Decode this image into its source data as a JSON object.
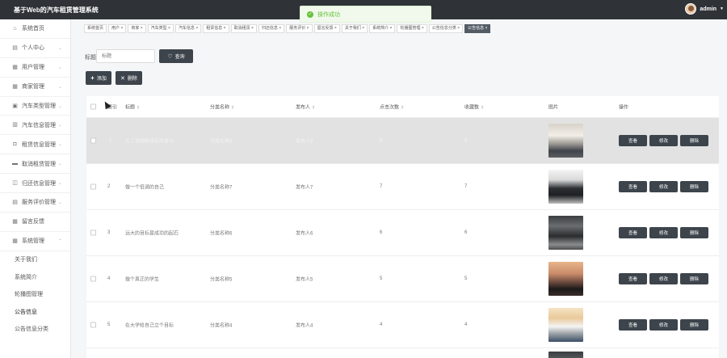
{
  "header": {
    "app_title": "基于Web的汽车租赁管理系统",
    "user_name": "admin",
    "user_caret": "▼"
  },
  "toast": {
    "icon": "check-circle-icon",
    "message": "操作成功"
  },
  "sidebar": {
    "items": [
      {
        "label": "系统首页",
        "icon": "home-icon"
      },
      {
        "label": "个人中心",
        "icon": "calendar-icon"
      },
      {
        "label": "用户管理",
        "icon": "grid-icon"
      },
      {
        "label": "商家管理",
        "icon": "grid-icon"
      },
      {
        "label": "汽车类型管理",
        "icon": "briefcase-icon"
      },
      {
        "label": "汽车信息管理",
        "icon": "building-icon"
      },
      {
        "label": "租赁信息管理",
        "icon": "database-icon"
      },
      {
        "label": "取消租赁管理",
        "icon": "chat-icon"
      },
      {
        "label": "归还信息管理",
        "icon": "layers-icon"
      },
      {
        "label": "服务评价管理",
        "icon": "list-icon"
      },
      {
        "label": "留言反馈",
        "icon": "book-icon"
      },
      {
        "label": "系统管理",
        "icon": "grid-icon"
      }
    ],
    "sub_items": [
      {
        "label": "关于我们"
      },
      {
        "label": "系统简介"
      },
      {
        "label": "轮播图管理"
      },
      {
        "label": "公告信息"
      },
      {
        "label": "公告信息分类"
      }
    ]
  },
  "tabs": [
    "系统首页",
    "用户 ×",
    "商家 ×",
    "汽车类型 ×",
    "汽车信息 ×",
    "租赁信息 ×",
    "取消租赁 ×",
    "归还信息 ×",
    "服务评价 ×",
    "留言反馈 ×",
    "关于我们 ×",
    "系统简介 ×",
    "轮播图管理 ×",
    "公告信息分类 ×",
    "公告信息 ×"
  ],
  "search": {
    "label": "标题",
    "placeholder": "标题",
    "button": "查询"
  },
  "actions": {
    "add": "添加",
    "delete": "删除"
  },
  "table": {
    "headers": [
      "索引",
      "标题",
      "分类名称",
      "发布人",
      "点击次数",
      "收藏数",
      "图片",
      "操作"
    ],
    "rows": [
      {
        "index": "1",
        "title": "在了理想和目标而奋斗",
        "category": "分类名称8",
        "publisher": "发布人8",
        "clicks": "8",
        "favorites": "8"
      },
      {
        "index": "2",
        "title": "做一个低调的自己",
        "category": "分类名称7",
        "publisher": "发布人7",
        "clicks": "7",
        "favorites": "7"
      },
      {
        "index": "3",
        "title": "远大的目标是成功的起石",
        "category": "分类名称6",
        "publisher": "发布人6",
        "clicks": "6",
        "favorites": "6"
      },
      {
        "index": "4",
        "title": "做个真正的学生",
        "category": "分类名称5",
        "publisher": "发布人5",
        "clicks": "5",
        "favorites": "5"
      },
      {
        "index": "5",
        "title": "在大学给自己立个目标",
        "category": "分类名称4",
        "publisher": "发布人4",
        "clicks": "4",
        "favorites": "4"
      }
    ],
    "row_actions": {
      "view": "查看",
      "edit": "修改",
      "delete": "删除"
    }
  },
  "colors": {
    "topbar": "#2f3337",
    "button": "#3d444b",
    "toast_green": "#67c23a",
    "highlight_row": "#e2e2e2"
  }
}
